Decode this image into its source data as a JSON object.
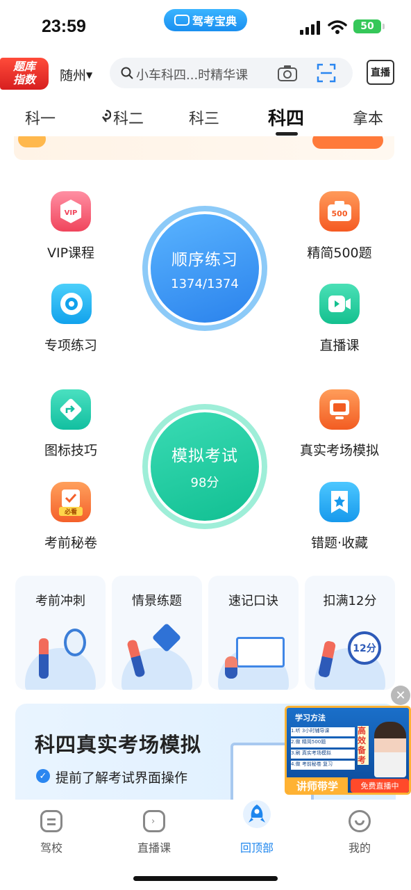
{
  "status_bar": {
    "time": "23:59",
    "app_name": "驾考宝典",
    "battery": "50"
  },
  "header": {
    "badge_line1": "题库",
    "badge_line2": "指数",
    "city": "随州",
    "search_placeholder": "小车科四...时精华课",
    "live_label": "直播"
  },
  "tabs": [
    "科一",
    "科二",
    "科三",
    "科四",
    "拿本"
  ],
  "active_tab": "科四",
  "features": {
    "vip": "VIP课程",
    "jingjian": "精简500题",
    "jingjian_badge": "500",
    "zhuanxiang": "专项练习",
    "zhibo": "直播课",
    "tubiao": "图标技巧",
    "zhenshi": "真实考场模拟",
    "miju": "考前秘卷",
    "miju_badge": "必看",
    "cuoti": "错题·收藏"
  },
  "sequence_practice": {
    "label": "顺序练习",
    "progress": "1374/1374"
  },
  "mock_exam": {
    "label": "模拟考试",
    "score": "98分"
  },
  "cards": [
    "考前冲刺",
    "情景练题",
    "速记口诀",
    "扣满12分"
  ],
  "card_badge_12": "12分",
  "promo": {
    "title": "科四真实考场模拟",
    "point1": "提前了解考试界面操作",
    "video_header": "学习方法",
    "video_items": [
      "1.听 3小时辅导课",
      "2.做 精简500题",
      "3.刷 真实考场模拟",
      "4.做 考前秘卷 复习"
    ],
    "video_side": "高效备考",
    "video_tag": "讲师带学",
    "video_live": "免费直播中"
  },
  "bottom_nav": [
    {
      "label": "驾校"
    },
    {
      "label": "直播课"
    },
    {
      "label": "回顶部"
    },
    {
      "label": "我的"
    }
  ],
  "colors": {
    "accent": "#1e86ee",
    "sequence_ring": "#3a9af5",
    "mock_ring": "#22c9a4"
  }
}
